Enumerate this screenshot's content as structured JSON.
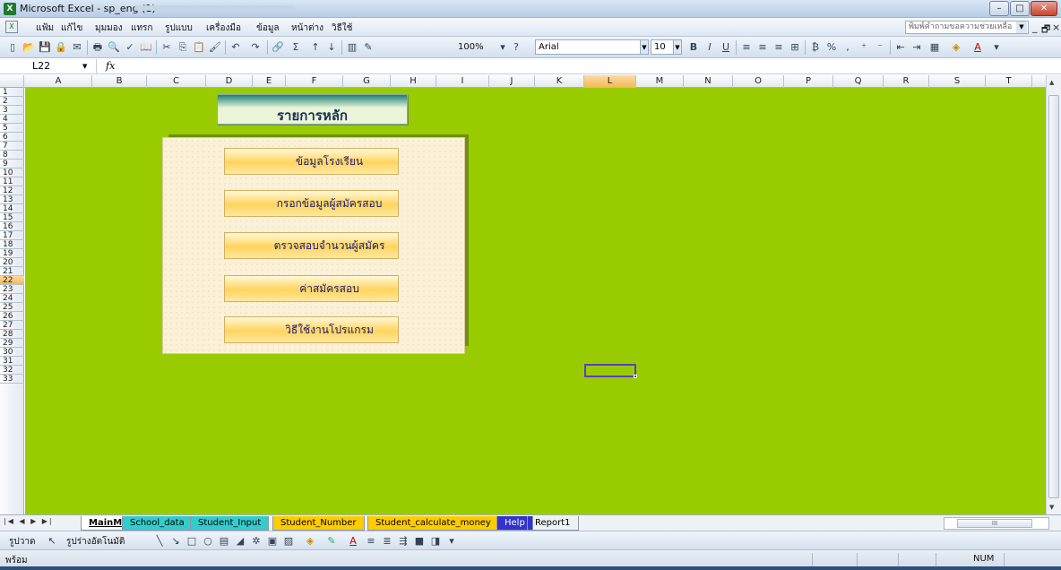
{
  "window": {
    "app_title": "Microsoft Excel - sp_eng (1)",
    "minimize": "–",
    "maximize": "□",
    "close": "✕"
  },
  "menubar": {
    "items": [
      "แฟ้ม",
      "แก้ไข",
      "มุมมอง",
      "แทรก",
      "รูปแบบ",
      "เครื่องมือ",
      "ข้อมูล",
      "หน้าต่าง",
      "วิธีใช้"
    ],
    "ask_placeholder": "พิมพ์คำถามขอความช่วยเหลือ",
    "doc_min": "_",
    "doc_restore": "🗗",
    "doc_close": "×"
  },
  "toolbar": {
    "zoom": "100%",
    "font": "Arial",
    "font_size": "10"
  },
  "formulabar": {
    "name_box": "L22",
    "fx": "fx"
  },
  "grid": {
    "columns": [
      "A",
      "B",
      "C",
      "D",
      "E",
      "F",
      "G",
      "H",
      "I",
      "J",
      "K",
      "L",
      "M",
      "N",
      "O",
      "P",
      "Q",
      "R",
      "S",
      "T"
    ],
    "rows": [
      "1",
      "2",
      "3",
      "4",
      "5",
      "6",
      "7",
      "8",
      "9",
      "10",
      "11",
      "12",
      "13",
      "14",
      "15",
      "16",
      "17",
      "18",
      "19",
      "20",
      "21",
      "22",
      "23",
      "24",
      "25",
      "26",
      "27",
      "28",
      "29",
      "30",
      "31",
      "32",
      "33"
    ],
    "active_col": "L",
    "active_row": "22",
    "sheet_color": "#99cc00"
  },
  "main_menu": {
    "header": "รายการหลัก",
    "buttons": [
      "ข้อมูลโรงเรียน",
      "กรอกข้อมูลผู้สมัครสอบ",
      "ตรวจสอบจำนวนผู้สมัคร",
      "ค่าสมัครสอบ",
      "วิธีใช้งานโปรแกรม"
    ]
  },
  "sheet_tabs": [
    {
      "label": "MainMenu",
      "color": "#ffffff"
    },
    {
      "label": "School_data",
      "color": "#33cccc"
    },
    {
      "label": "Student_Input",
      "color": "#33cccc"
    },
    {
      "label": "Student_Number",
      "color": "#ffcc00"
    },
    {
      "label": "Student_calculate_money",
      "color": "#ffcc00"
    },
    {
      "label": "Help",
      "color": "#3333cc"
    },
    {
      "label": "Report1",
      "color": "#ffffff"
    }
  ],
  "drawbar": {
    "draw_label": "รูปวาด",
    "autoshapes_label": "รูปร่างอัตโนมัติ"
  },
  "statusbar": {
    "status": "พร้อม",
    "num": "NUM"
  }
}
